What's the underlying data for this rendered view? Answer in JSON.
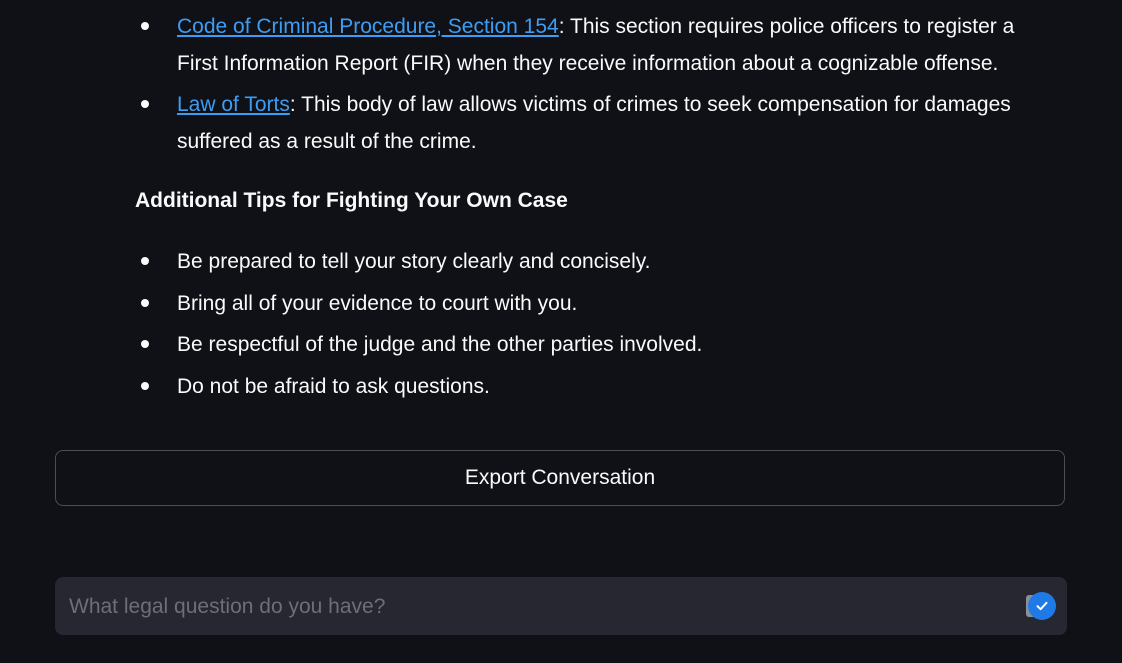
{
  "laws": [
    {
      "link_text": "Code of Criminal Procedure, Section 154",
      "description": ": This section requires police officers to register a First Information Report (FIR) when they receive information about a cognizable offense."
    },
    {
      "link_text": "Law of Torts",
      "description": ": This body of law allows victims of crimes to seek compensation for damages suffered as a result of the crime."
    }
  ],
  "tips": {
    "heading": "Additional Tips for Fighting Your Own Case",
    "items": [
      "Be prepared to tell your story clearly and concisely.",
      "Bring all of your evidence to court with you.",
      "Be respectful of the judge and the other parties involved.",
      "Do not be afraid to ask questions."
    ]
  },
  "export_button": {
    "label": "Export Conversation"
  },
  "chat": {
    "placeholder": "What legal question do you have?",
    "value": ""
  },
  "colors": {
    "background": "#0f1117",
    "text": "#fafafa",
    "link": "#3d9df3",
    "input_bg": "#262730",
    "accent": "#1f7ae6"
  },
  "icons": {
    "send": "check-circle-icon"
  }
}
